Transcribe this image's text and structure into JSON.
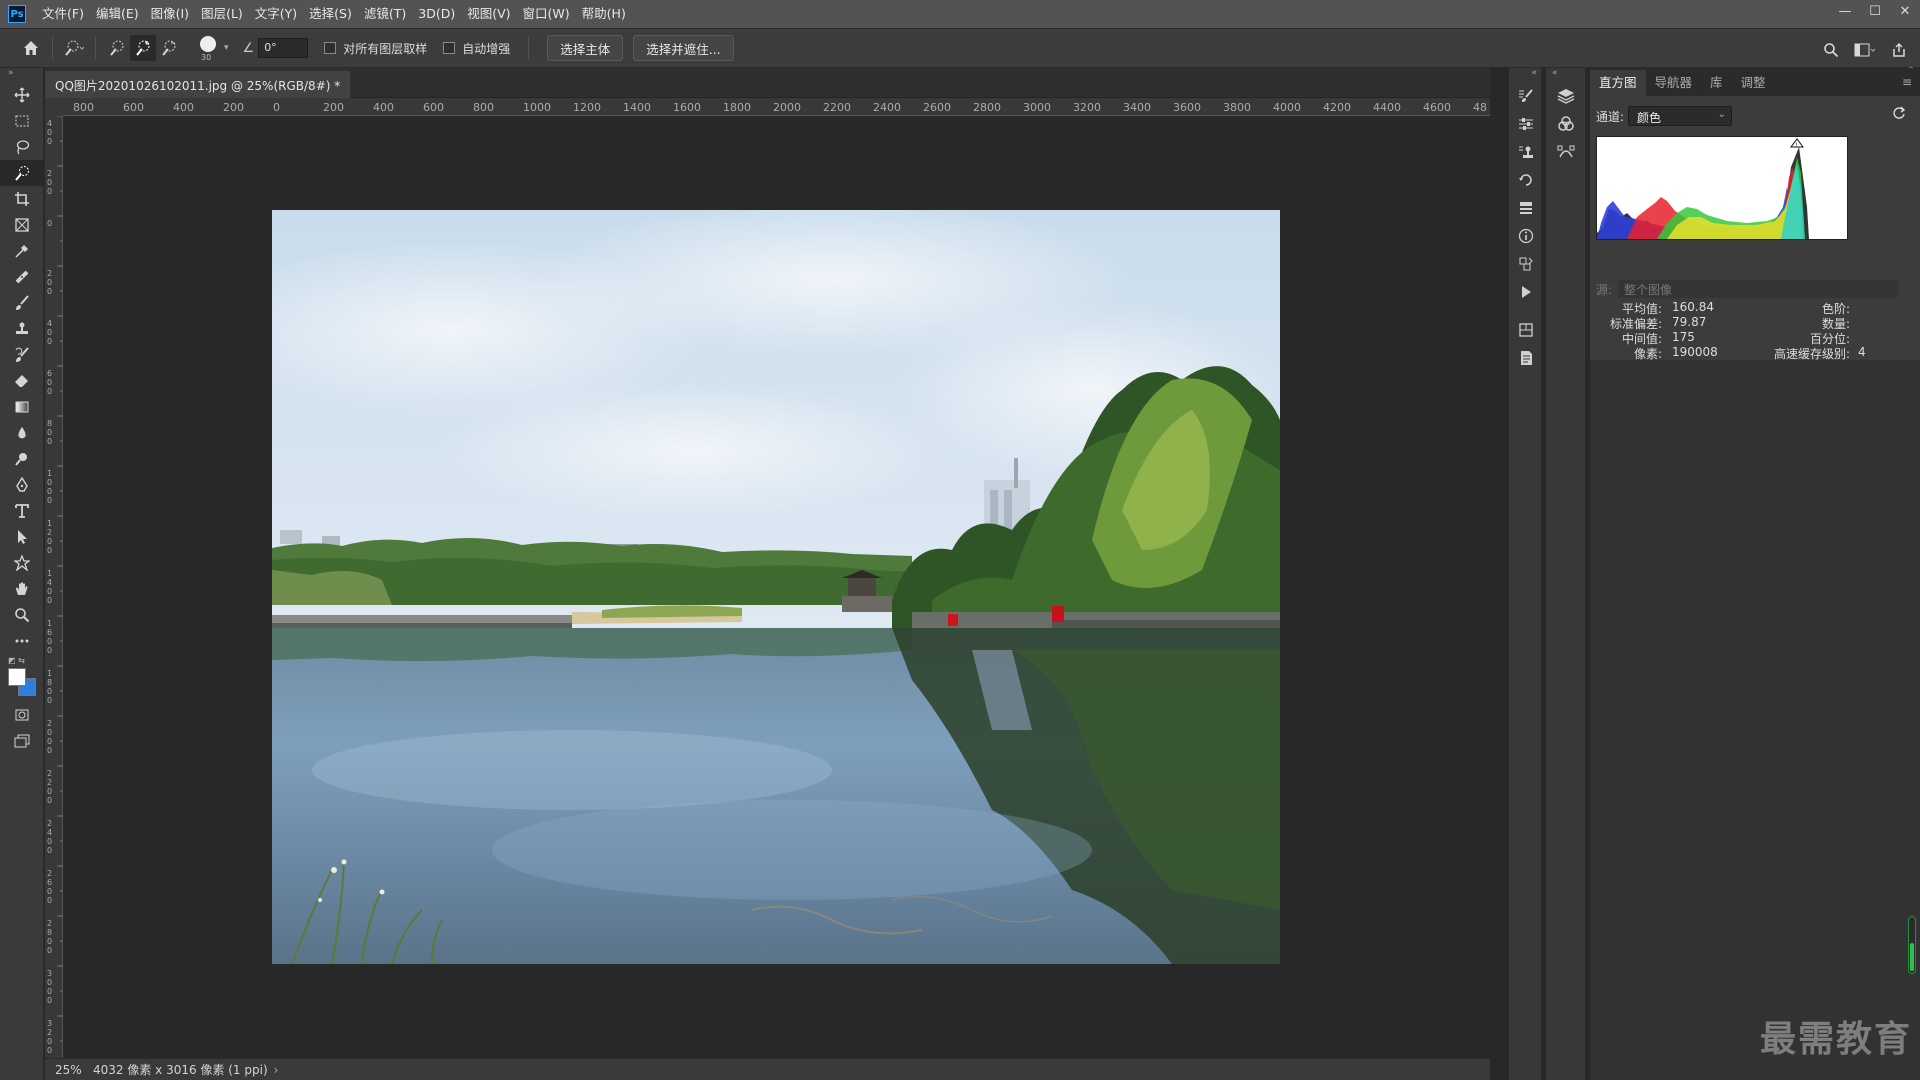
{
  "app": {
    "logo": "Ps"
  },
  "menu": [
    "文件(F)",
    "编辑(E)",
    "图像(I)",
    "图层(L)",
    "文字(Y)",
    "选择(S)",
    "滤镜(T)",
    "3D(D)",
    "视图(V)",
    "窗口(W)",
    "帮助(H)"
  ],
  "window_controls": {
    "minimize": "—",
    "maximize": "☐",
    "close": "✕"
  },
  "options": {
    "brush_size": "30",
    "angle": "0°",
    "sample_all_layers": "对所有图层取样",
    "auto_enhance": "自动增强",
    "select_subject": "选择主体",
    "select_mask": "选择并遮住..."
  },
  "document": {
    "tab_title": "QQ图片20201026102011.jpg @ 25%(RGB/8#) *",
    "tab_close": "×",
    "zoom": "25%",
    "size_info": "4032 像素 x 3016 像素 (1 ppi)",
    "ruler_ticks": [
      "800",
      "600",
      "400",
      "200",
      "0",
      "200",
      "400",
      "600",
      "800",
      "1000",
      "1200",
      "1400",
      "1600",
      "1800",
      "2000",
      "2200",
      "2400",
      "2600",
      "2800",
      "3000",
      "3200",
      "3400",
      "3600",
      "3800",
      "4000",
      "4200",
      "4400",
      "4600",
      "48"
    ]
  },
  "histogram_panel": {
    "tabs": [
      "直方图",
      "导航器",
      "库",
      "调整"
    ],
    "channel_label": "通道:",
    "channel_value": "颜色",
    "source_label": "源:",
    "source_value": "整个图像",
    "stats_left": [
      {
        "label": "平均值:",
        "value": "160.84"
      },
      {
        "label": "标准偏差:",
        "value": "79.87"
      },
      {
        "label": "中间值:",
        "value": "175"
      },
      {
        "label": "像素:",
        "value": "190008"
      }
    ],
    "stats_right": [
      {
        "label": "色阶:",
        "value": ""
      },
      {
        "label": "数量:",
        "value": ""
      },
      {
        "label": "百分位:",
        "value": ""
      },
      {
        "label": "高速缓存级别:",
        "value": "4"
      }
    ]
  },
  "watermark": "最需教育"
}
